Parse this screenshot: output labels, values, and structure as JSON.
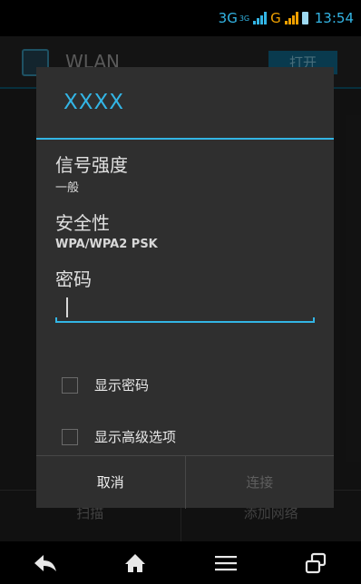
{
  "status_bar": {
    "network": "3G",
    "network_small": "3G",
    "carrier_g": "G",
    "time": "13:54"
  },
  "background_screen": {
    "title": "WLAN",
    "toggle_label": "打开",
    "bottom_actions": [
      "扫描",
      "添加网络"
    ]
  },
  "dialog": {
    "title": "XXXX",
    "signal_label": "信号强度",
    "signal_value": "一般",
    "security_label": "安全性",
    "security_value": "WPA/WPA2 PSK",
    "password_label": "密码",
    "password_value": "",
    "show_password_label": "显示密码",
    "show_password_checked": false,
    "show_advanced_label": "显示高级选项",
    "show_advanced_checked": false,
    "cancel_label": "取消",
    "connect_label": "连接"
  },
  "nav_bar": {
    "icons": [
      "back-icon",
      "home-icon",
      "menu-icon",
      "recent-apps-icon"
    ]
  },
  "colors": {
    "accent": "#33b5e5",
    "dialog_bg": "#2f2f2f",
    "disabled_text": "#5e5e5e"
  }
}
